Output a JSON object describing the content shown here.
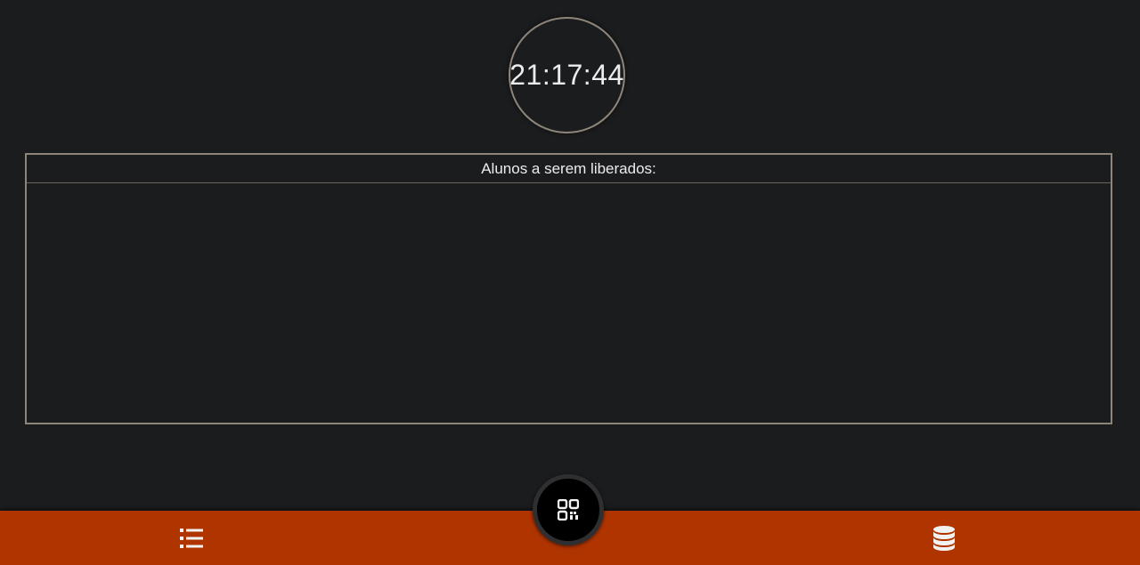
{
  "clock": {
    "time": "21:17:44"
  },
  "release_list": {
    "header": "Alunos a serem liberados:",
    "items": []
  },
  "bottom_nav": {
    "left_icon": "list-icon",
    "center_icon": "qr-code-icon",
    "right_icon": "database-icon",
    "bar_color": "#b03400"
  }
}
